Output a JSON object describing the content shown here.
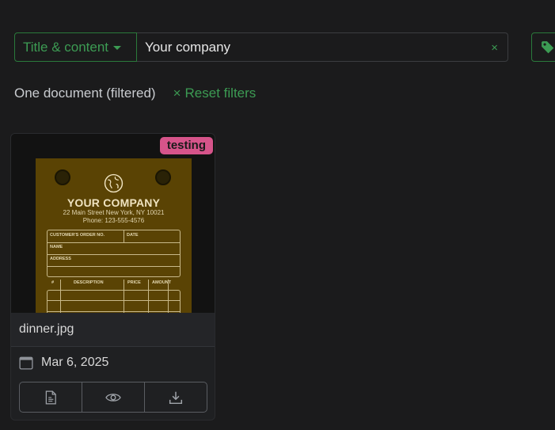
{
  "filter": {
    "field_select_label": "Title & content",
    "query_value": "Your company",
    "clear_symbol": "×"
  },
  "status": {
    "count_text": "One document (filtered)",
    "reset_symbol": "×",
    "reset_label": "Reset filters"
  },
  "document": {
    "tag": "testing",
    "title": "dinner.jpg",
    "date": "Mar 6, 2025",
    "thumbnail": {
      "company_name": "YOUR COMPANY",
      "address": "22 Main Street New York, NY 10021",
      "phone": "Phone: 123-555-4576",
      "labels": {
        "order_no": "CUSTOMER'S ORDER NO.",
        "date": "DATE",
        "name": "NAME",
        "address": "ADDRESS",
        "col_num": "#",
        "col_desc": "DESCRIPTION",
        "col_price": "PRICE",
        "col_amount": "AMOUNT"
      }
    },
    "actions": [
      "details",
      "preview",
      "download"
    ]
  },
  "icons": {
    "caret": "chevron-down-icon",
    "tags": "tag-icon",
    "calendar": "calendar-icon",
    "details": "document-icon",
    "preview": "eye-icon",
    "download": "download-icon"
  },
  "colors": {
    "accent": "#3c9b53",
    "tag_bg": "#d6548a",
    "background": "#1b1b1c",
    "card_bg": "#1f2022"
  }
}
